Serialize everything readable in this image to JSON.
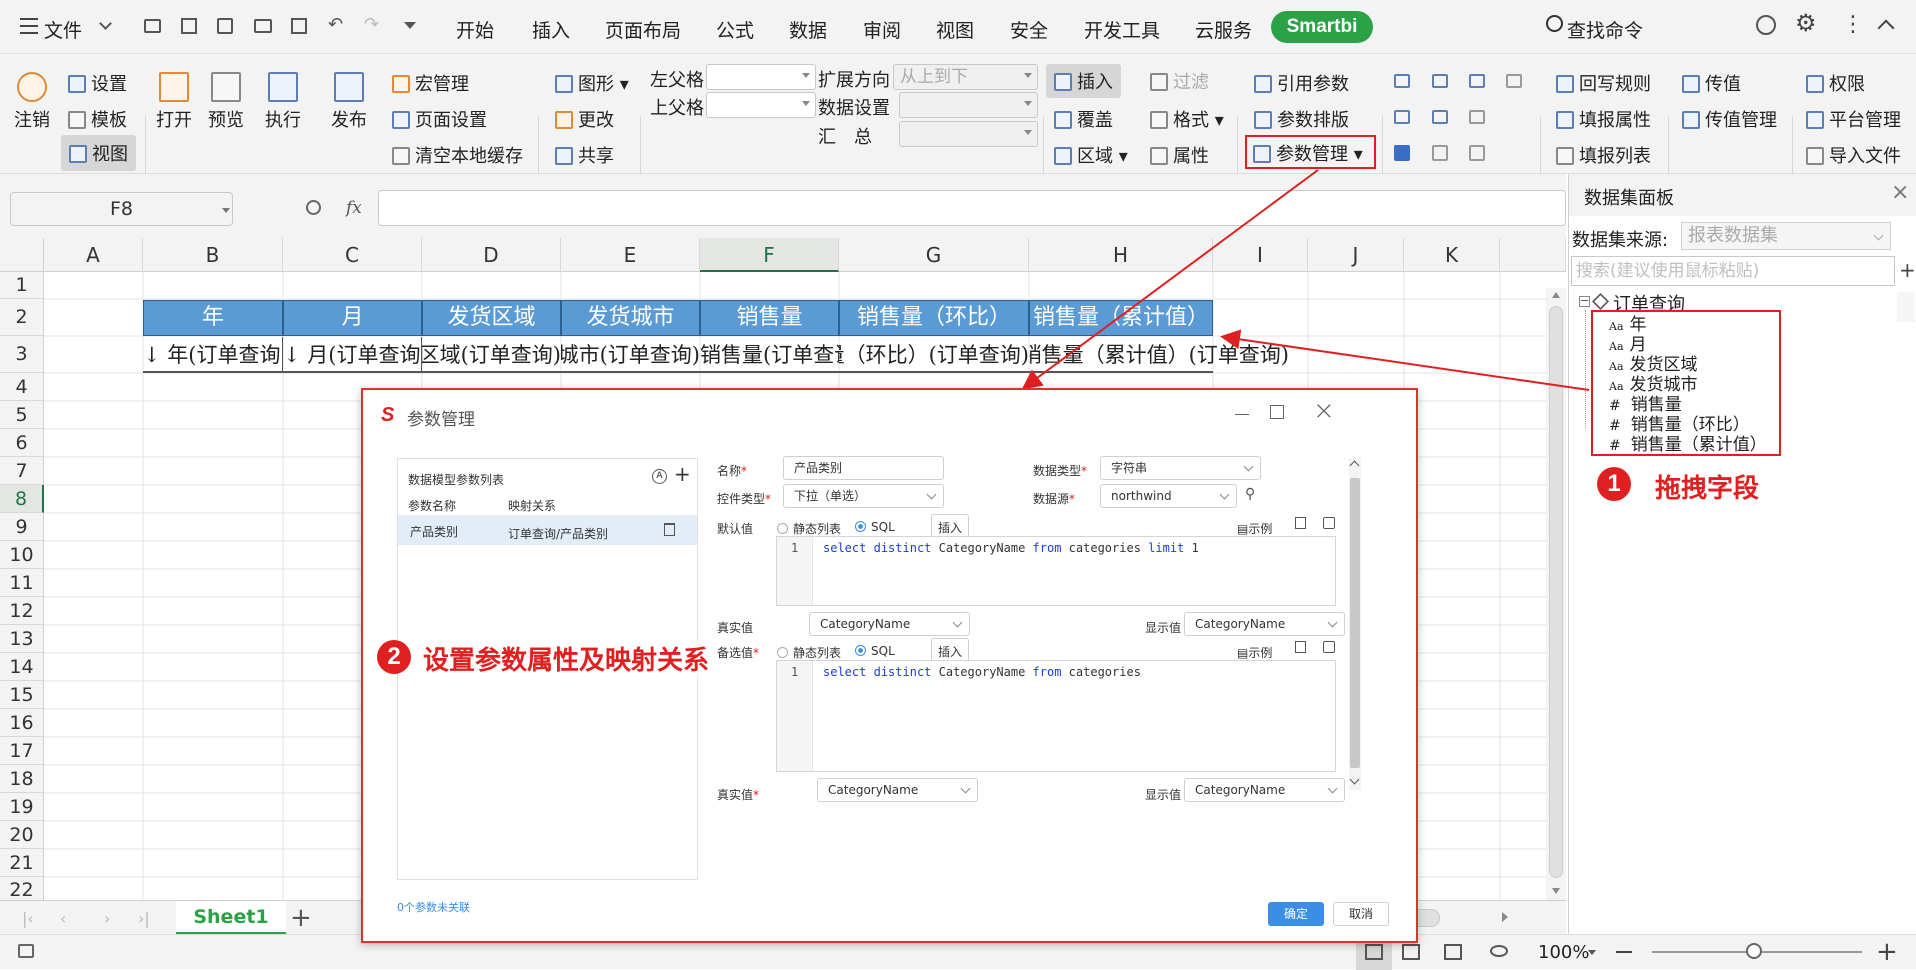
{
  "menubar": {
    "file": "文件",
    "tabs": [
      "开始",
      "插入",
      "页面布局",
      "公式",
      "数据",
      "审阅",
      "视图",
      "安全",
      "开发工具",
      "云服务"
    ],
    "smartbi": "Smartbi",
    "search": "查找命令"
  },
  "ribbon": {
    "logout": "注销",
    "settings": "设置",
    "template": "模板",
    "view": "视图",
    "open": "打开",
    "preview": "预览",
    "execute": "执行",
    "publish": "发布",
    "macro_manage": "宏管理",
    "page_setup": "页面设置",
    "clear_cache": "清空本地缓存",
    "shape": "图形",
    "change": "更改",
    "share": "共享",
    "left_parent": "左父格",
    "top_parent": "上父格",
    "expand_direction": "扩展方向",
    "expand_direction_value": "从上到下",
    "data_settings": "数据设置",
    "summary": "汇　总",
    "insert": "插入",
    "filter": "过滤",
    "overwrite": "覆盖",
    "format": "格式",
    "region": "区域",
    "property": "属性",
    "ref_param": "引用参数",
    "param_layout": "参数排版",
    "param_manage": "参数管理",
    "writeback_rule": "回写规则",
    "fill_property": "填报属性",
    "fill_list": "填报列表",
    "pass_value": "传值",
    "pass_value_manage": "传值管理",
    "permission": "权限",
    "platform_manage": "平台管理",
    "import_file": "导入文件"
  },
  "formula": {
    "cell_ref": "F8",
    "fx": "fx",
    "value": ""
  },
  "sheet": {
    "columns": [
      "A",
      "B",
      "C",
      "D",
      "E",
      "F",
      "G",
      "H",
      "I",
      "J",
      "K"
    ],
    "rows": [
      "1",
      "2",
      "3",
      "4",
      "5",
      "6",
      "7",
      "8",
      "9",
      "10",
      "11",
      "12",
      "13",
      "14",
      "15",
      "16",
      "17",
      "18",
      "19",
      "20",
      "21",
      "22"
    ],
    "header_row": [
      "年",
      "月",
      "发货区域",
      "发货城市",
      "销售量",
      "销售量（环比）",
      "销售量（累计值）"
    ],
    "field_row": [
      "↓ 年(订单查询)",
      "↓ 月(订单查询)",
      "发货区域(订单查询)",
      "发货城市(订单查询)",
      "销售量(订单查询)",
      "销售量（环比）(订单查询)",
      "销售量（累计值）(订单查询)"
    ],
    "tab": "Sheet1"
  },
  "dataset_panel": {
    "title": "数据集面板",
    "source_label": "数据集来源:",
    "source_value": "报表数据集",
    "search_placeholder": "搜索(建议使用鼠标粘贴)",
    "root": "订单查询",
    "fields": [
      {
        "type": "Aa",
        "name": "年"
      },
      {
        "type": "Aa",
        "name": "月"
      },
      {
        "type": "Aa",
        "name": "发货区域"
      },
      {
        "type": "Aa",
        "name": "发货城市"
      },
      {
        "type": "#",
        "name": "销售量"
      },
      {
        "type": "#",
        "name": "销售量（环比）"
      },
      {
        "type": "#",
        "name": "销售量（累计值）"
      }
    ]
  },
  "annotations": {
    "step1_num": "1",
    "step1_text": "拖拽字段",
    "step2_num": "2",
    "step2_text": "设置参数属性及映射关系"
  },
  "dialog": {
    "title": "参数管理",
    "list_title": "数据模型参数列表",
    "col_name": "参数名称",
    "col_mapping": "映射关系",
    "param_name": "产品类别",
    "param_mapping": "订单查询/产品类别",
    "footer_status": "0个参数未关联",
    "name_label": "名称",
    "name_value": "产品类别",
    "data_type_label": "数据类型",
    "data_type_value": "字符串",
    "control_type_label": "控件类型",
    "control_type_value": "下拉（单选）",
    "datasource_label": "数据源",
    "datasource_value": "northwind",
    "default_label": "默认值",
    "static_list": "静态列表",
    "sql": "SQL",
    "insert_btn": "插入",
    "example": "示例",
    "default_sql_line": "1",
    "default_sql": "select distinct CategoryName from categories limit 1",
    "true_value_label": "真实值",
    "true_value": "CategoryName",
    "display_value_label": "显示值",
    "display_value": "CategoryName",
    "candidate_label": "备选值",
    "candidate_sql_line": "1",
    "candidate_sql": "select distinct CategoryName from categories",
    "ok": "确定",
    "cancel": "取消"
  },
  "statusbar": {
    "zoom": "100%"
  }
}
